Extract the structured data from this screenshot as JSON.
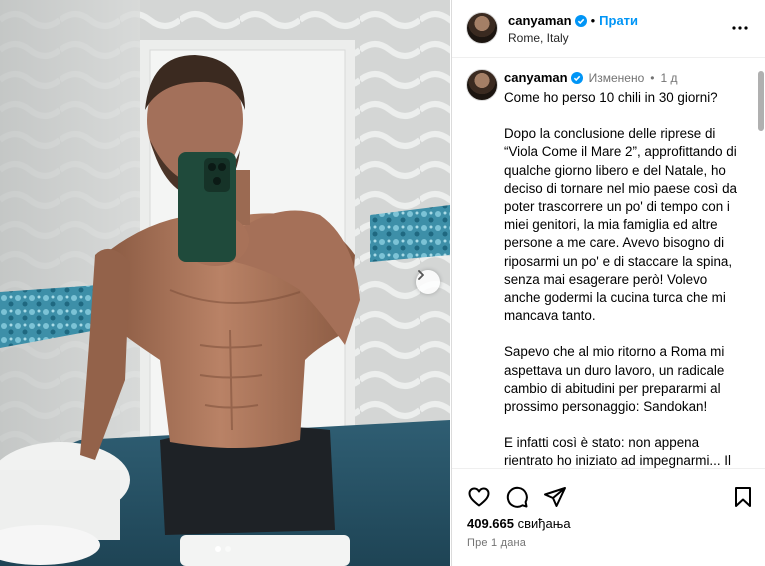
{
  "post": {
    "username": "canyaman",
    "verified": true,
    "follow_label": "Прати",
    "separator": "•",
    "location": "Rome, Italy"
  },
  "caption": {
    "username": "canyaman",
    "edited": "Изменено",
    "dot": "•",
    "age": "1 д",
    "paragraphs": [
      "Come ho perso 10 chili in 30 giorni?",
      "Dopo la conclusione delle riprese di “Viola Come il Mare 2”, approfittando di qualche giorno libero e del Natale, ho deciso di tornare nel mio paese così da poter trascorrere un po' di tempo con i miei genitori, la mia famiglia ed altre persone a me care. Avevo bisogno di riposarmi un po' e di staccare la spina, senza mai esagerare però! Volevo anche godermi la cucina turca che mi mancava tanto.",
      "Sapevo che al mio ritorno a Roma mi aspettava un duro lavoro, un radicale cambio di abitudini per prepararmi al prossimo personaggio: Sandokan!",
      "E infatti così è stato: non appena rientrato ho iniziato ad impegnarmi... Il primo obiettivo era raggiungere il peso ideale per il personaggio e poi"
    ]
  },
  "stats": {
    "likes_count": "409.665",
    "likes_label": "свиђања",
    "time": "Пре 1 дана"
  },
  "carousel": {
    "slide_count": 2,
    "active_slide": 1
  },
  "icons": {
    "like": "heart-icon",
    "comment": "comment-icon",
    "share": "send-icon",
    "save": "bookmark-icon",
    "more": "more-icon",
    "next": "chevron-right-icon",
    "verified": "verified-badge-icon"
  },
  "colors": {
    "link": "#0095f6",
    "verified": "#0095f6",
    "muted": "#737373"
  }
}
